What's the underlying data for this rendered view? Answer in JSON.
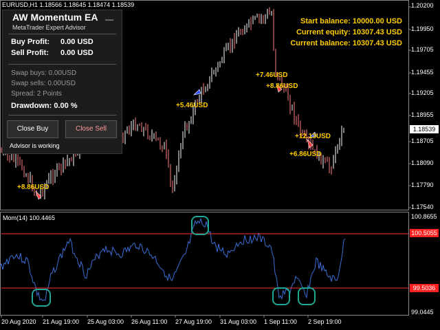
{
  "header": {
    "symbol_info": "EURUSD,H1  1.18566 1.18645 1.18474 1.18539"
  },
  "balances": {
    "start": "Start balance: 10000.00 USD",
    "equity": "Current equity: 10307.43 USD",
    "balance": "Current balance: 10307.43 USD"
  },
  "price_axis": {
    "labels": [
      "1.20200",
      "1.19950",
      "1.19705",
      "1.19455",
      "1.19205",
      "1.18955",
      "1.18705",
      "1.18340",
      "1.18090",
      "1.17790",
      "1.17540"
    ],
    "current_price": "1.18539"
  },
  "indicator": {
    "name": "Mom(14) 100.4465",
    "axis_labels": [
      "100.8655",
      "100.5055",
      "99.5036",
      "99.0445"
    ]
  },
  "time_axis": [
    "20 Aug 2020",
    "21 Aug 19:00",
    "25 Aug 03:00",
    "26 Aug 11:00",
    "27 Aug 19:00",
    "31 Aug 03:00",
    "1 Sep 11:00",
    "2 Sep 19:00"
  ],
  "trade_labels": [
    "+8.86USD",
    "+5.46USD",
    "+7.46USD",
    "+8.86USD",
    "+12.13USD",
    "+6.86USD"
  ],
  "panel": {
    "title": "AW Momentum EA",
    "subtitle": "MetaTrader Expert Advisor",
    "minimize": "—",
    "buy_profit_label": "Buy Profit:",
    "buy_profit_value": "0.00 USD",
    "sell_profit_label": "Sell Profit:",
    "sell_profit_value": "0.00 USD",
    "swap_buys": "Swap buys: 0.00USD",
    "swap_sells": "Swap sells: 0.00USD",
    "spread": "Spread: 2 Points",
    "drawdown": "Drawdown: 0.00 %",
    "close_buy": "Close Buy",
    "close_sell": "Close Sell",
    "status": "Advisor is working"
  },
  "colors": {
    "bull": "#ffffff",
    "bear": "#ff8080",
    "momentum": "#3a6fd8",
    "level": "#ff3333",
    "price_text": "#ffcc00",
    "highlight": "#1fa894"
  }
}
